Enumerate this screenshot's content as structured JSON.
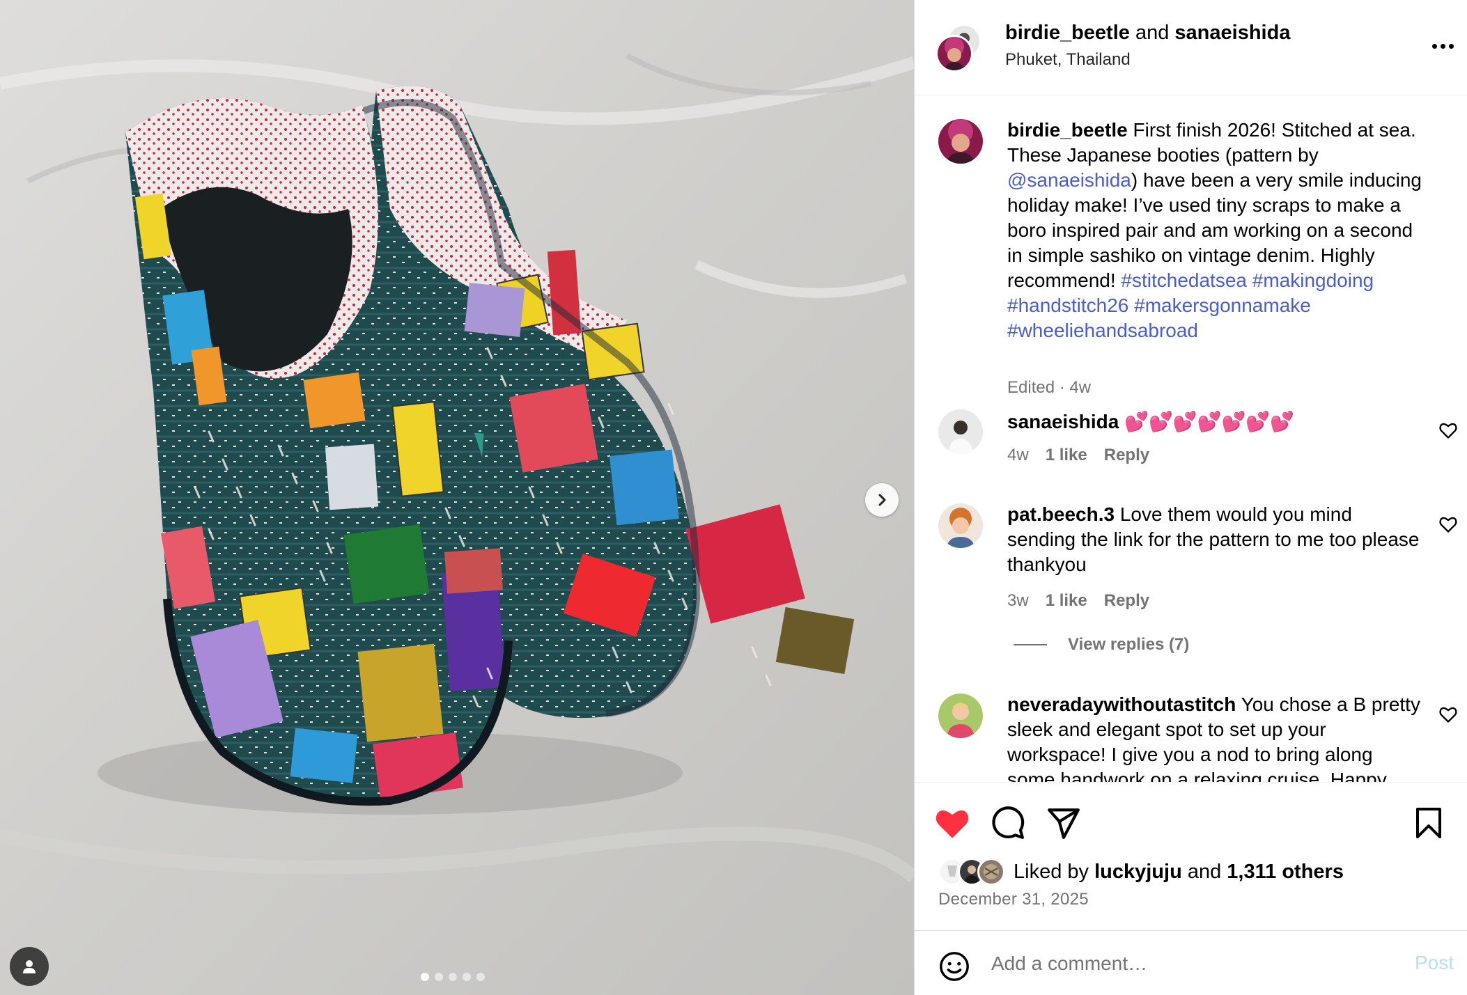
{
  "header": {
    "user1": "birdie_beetle",
    "conj": "and",
    "user2": "sanaeishida",
    "location": "Phuket, Thailand"
  },
  "caption": {
    "username": "birdie_beetle",
    "text1": "First finish 2026! Stitched at sea. These Japanese booties (pattern by ",
    "mention": "@sanaeishida",
    "text2": ") have been a very smile inducing holiday make! I’ve used tiny scraps to make a boro inspired pair and am working on a second in simple sashiko on vintage denim. Highly recommend! ",
    "tag1": "#stitchedatsea",
    "tag2": "#makingdoing",
    "tag3": "#handstitch26",
    "tag4": "#makersgonnamake",
    "tag5": "#wheeliehandsabroad",
    "meta": "Edited · 4w"
  },
  "comments": [
    {
      "username": "sanaeishida",
      "text": "💕💕💕💕💕💕💕",
      "time": "4w",
      "likes": "1 like",
      "reply": "Reply"
    },
    {
      "username": "pat.beech.3",
      "text": "Love them would you mind sending the link for the pattern to me too please thankyou",
      "time": "3w",
      "likes": "1 like",
      "reply": "Reply"
    },
    {
      "username": "neveradaywithoutastitch",
      "text": "You chose a B pretty sleek and elegant spot to set up your workspace! I give you a nod to bring along some handwork on a relaxing cruise. Happy"
    }
  ],
  "view_replies": "View replies (7)",
  "likes": {
    "prefix": "Liked by",
    "user": "luckyjuju",
    "mid": "and",
    "count": "1,311 others"
  },
  "date": "December 31, 2025",
  "add_comment": {
    "placeholder": "Add a comment…",
    "post": "Post"
  },
  "icons": [
    "heart-icon",
    "comment-icon",
    "share-icon",
    "bookmark-icon",
    "emoji-icon",
    "more-icon",
    "next-arrow-icon",
    "user-tag-icon"
  ],
  "colors": {
    "like_red": "#ff3040",
    "link_blue": "#4a5dcd",
    "muted": "#737373",
    "post_disabled": "#b2dffc"
  },
  "carousel": {
    "total": 5,
    "active": 1
  }
}
